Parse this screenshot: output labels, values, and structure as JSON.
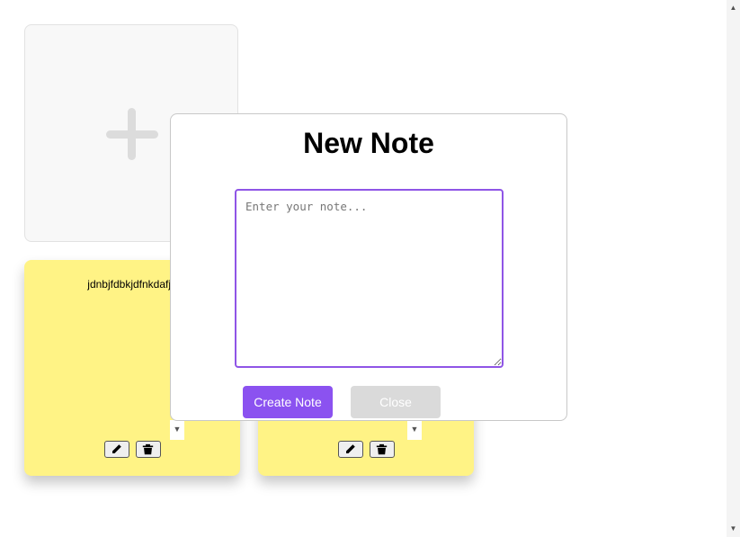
{
  "add_card": {
    "icon": "plus-icon"
  },
  "notes": [
    {
      "text": "jdnbjfdbkjdfnkdafjn",
      "edit_icon": "pencil-icon",
      "delete_icon": "trash-icon"
    },
    {
      "text": "",
      "edit_icon": "pencil-icon",
      "delete_icon": "trash-icon"
    }
  ],
  "modal": {
    "title": "New Note",
    "textarea": {
      "value": "",
      "placeholder": "Enter your note..."
    },
    "create_label": "Create Note",
    "close_label": "Close"
  },
  "colors": {
    "note_yellow": "#fff385",
    "accent_purple": "#8b52f0",
    "disabled_gray": "#dadada"
  }
}
